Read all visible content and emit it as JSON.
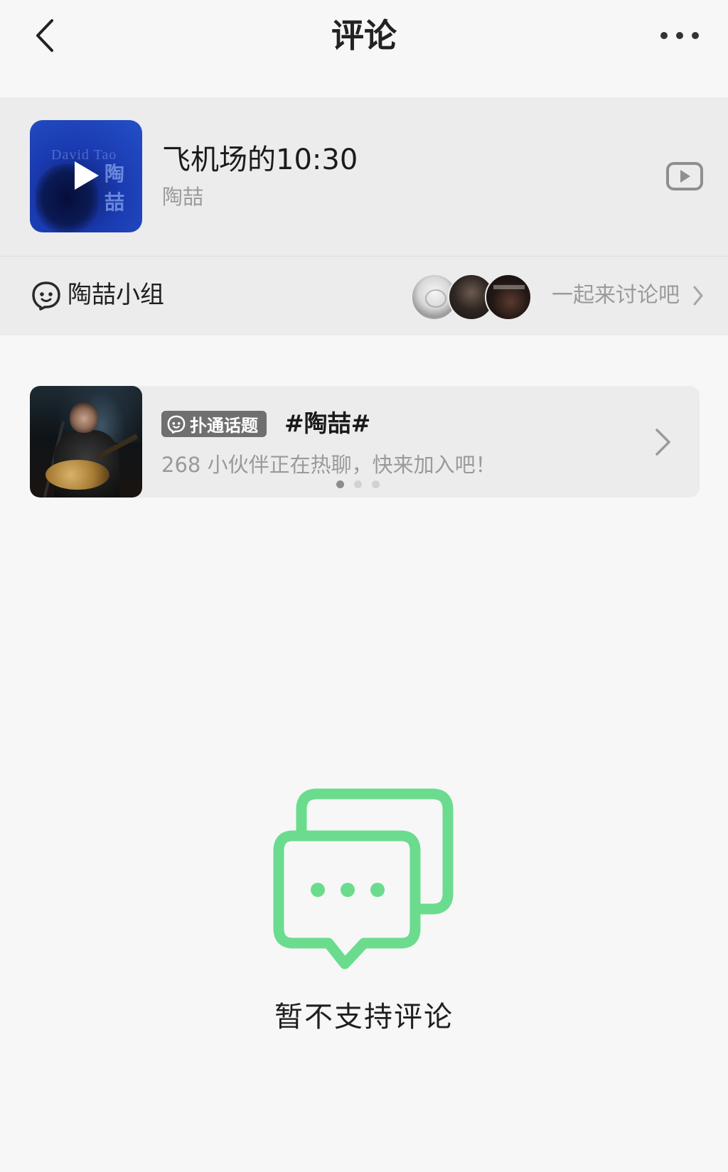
{
  "header": {
    "title": "评论"
  },
  "song": {
    "title": "飞机场的10:30",
    "artist": "陶喆",
    "cover_text": "David Tao",
    "cover_text_cn": "陶喆"
  },
  "group": {
    "name": "陶喆小组",
    "cta": "一起来讨论吧"
  },
  "topic": {
    "tag": "扑通话题",
    "name": "#陶喆#",
    "description": "268 小伙伴正在热聊，快来加入吧！",
    "page_count": 3,
    "active_page": 1
  },
  "empty_state": {
    "message": "暂不支持评论"
  },
  "colors": {
    "accent_green": "#6bdc8e",
    "background": "#f7f7f7",
    "card_background": "#ececec",
    "muted_text": "#9a9a9a",
    "tag_background": "#6f6f6f"
  },
  "icons": {
    "back": "back-arrow-icon",
    "more": "more-dots-icon",
    "play": "play-icon",
    "mv": "video-play-icon",
    "group": "group-face-icon",
    "chevron": "chevron-right-icon",
    "empty": "chat-bubbles-icon"
  }
}
